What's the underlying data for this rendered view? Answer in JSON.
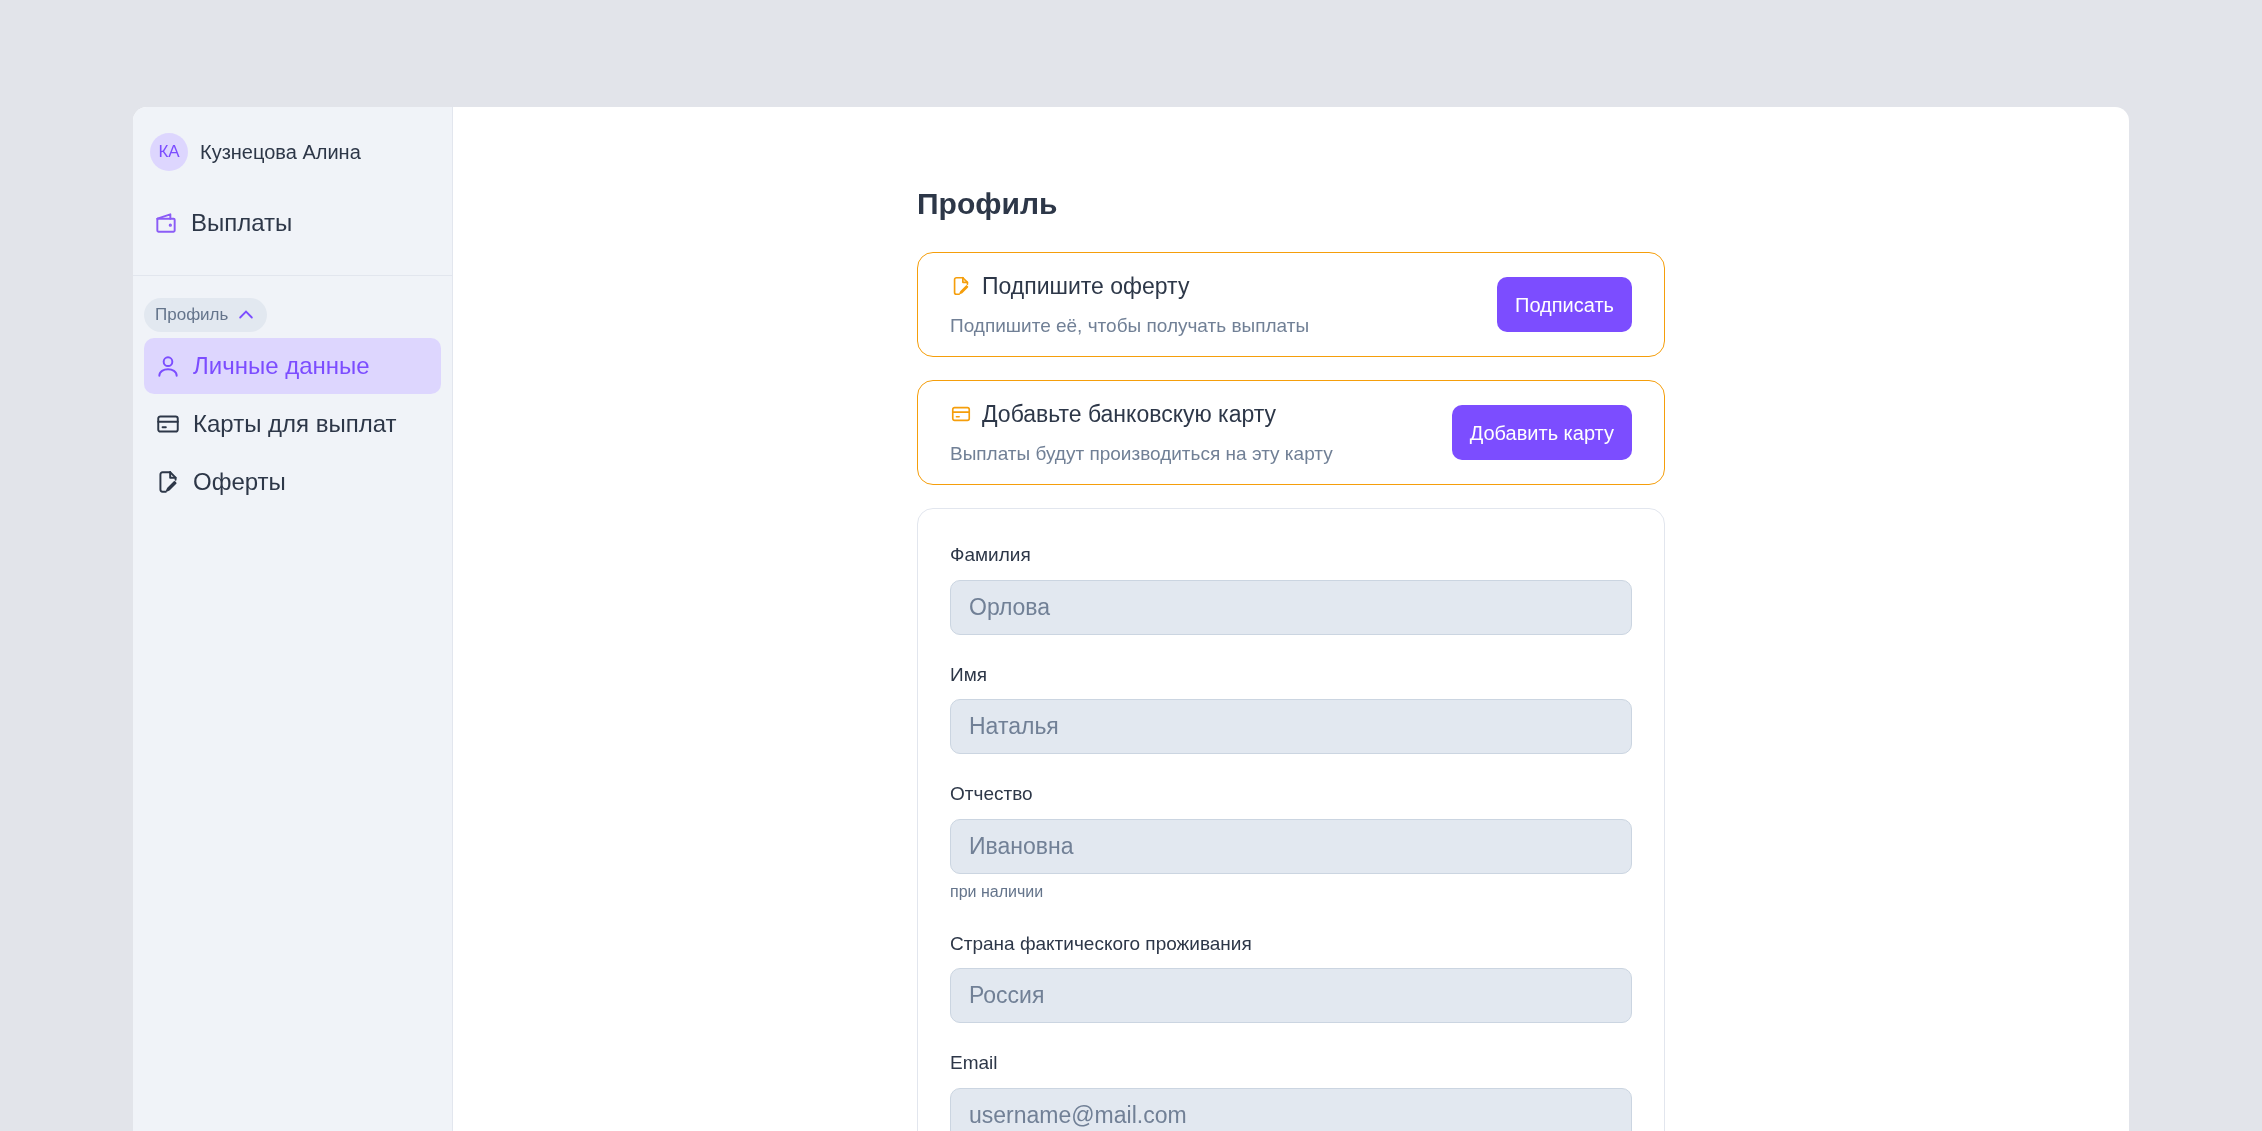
{
  "user": {
    "initials": "КА",
    "name": "Кузнецова Алина"
  },
  "top_nav": [
    {
      "label": "Выплаты",
      "kind": "wallet",
      "selected": false
    }
  ],
  "sidebar_group": {
    "label": "Профиль",
    "expanded": true,
    "items": [
      {
        "label": "Личные данные",
        "kind": "user",
        "selected": true
      },
      {
        "label": "Карты для выплат",
        "kind": "card",
        "selected": false
      },
      {
        "label": "Оферты",
        "kind": "doc",
        "selected": false
      }
    ]
  },
  "page_title": "Профиль",
  "alerts": [
    {
      "kind": "doc",
      "title": "Подпишите оферту",
      "text": "Подпишите её, чтобы получать выплаты",
      "button": "Подписать"
    },
    {
      "kind": "card",
      "title": "Добавьте банковскую карту",
      "text": "Выплаты будут производиться на эту карту",
      "button": "Добавить карту"
    }
  ],
  "fields": [
    {
      "label": "Фамилия",
      "value": "Орлова",
      "disabled": true
    },
    {
      "label": "Имя",
      "value": "Наталья",
      "disabled": true
    },
    {
      "label": "Отчество",
      "value": "Ивановна",
      "disabled": true,
      "hint": "при наличии"
    },
    {
      "label": "Страна фактического проживания",
      "value": "Россия",
      "disabled": true
    },
    {
      "label": "Email",
      "value": "username@mail.com",
      "disabled": true
    }
  ]
}
